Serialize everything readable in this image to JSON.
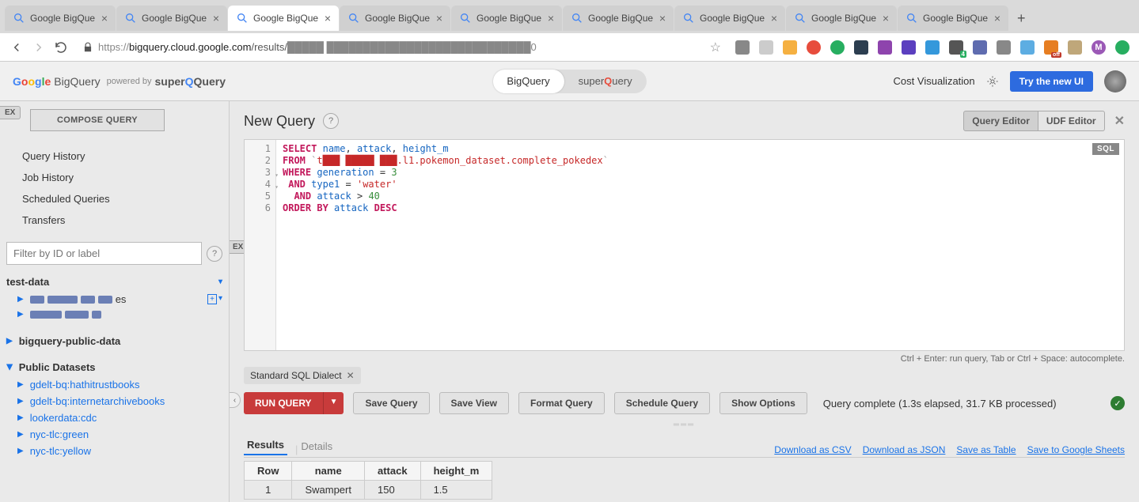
{
  "tabs": {
    "title": "Google BigQue",
    "count": 9,
    "active_index": 2,
    "new_tab_symbol": "+"
  },
  "browser": {
    "url_prefix": "https://",
    "url_host": "bigquery.cloud.google.com",
    "url_path": "/results/",
    "url_obscured": "█████ ████████████████████████████0"
  },
  "app_header": {
    "brand": "BigQuery",
    "powered_by": "powered by",
    "super": "super",
    "query": "Query",
    "toggle_left": "BigQuery",
    "toggle_right": "superQuery",
    "cost_vis": "Cost Visualization",
    "try_btn": "Try the new UI"
  },
  "sidebar": {
    "ex_badge": "EX",
    "compose": "COMPOSE QUERY",
    "links": [
      "Query History",
      "Job History",
      "Scheduled Queries",
      "Transfers"
    ],
    "filter_placeholder": "Filter by ID or label",
    "project1": "test-data",
    "ds1_suffix": "es",
    "project2": "bigquery-public-data",
    "project3": "Public Datasets",
    "public": [
      "gdelt-bq:hathitrustbooks",
      "gdelt-bq:internetarchivebooks",
      "lookerdata:cdc",
      "nyc-tlc:green",
      "nyc-tlc:yellow"
    ]
  },
  "content": {
    "title": "New Query",
    "query_editor": "Query Editor",
    "udf_editor": "UDF Editor",
    "sql_badge": "SQL",
    "hint": "Ctrl + Enter: run query, Tab or Ctrl + Space: autocomplete.",
    "dialect_chip": "Standard SQL Dialect",
    "run": "RUN QUERY",
    "save_query": "Save Query",
    "save_view": "Save View",
    "format_query": "Format Query",
    "schedule_query": "Schedule Query",
    "show_options": "Show Options",
    "status": "Query complete (1.3s elapsed, 31.7 KB processed)",
    "results_tab": "Results",
    "details_tab": "Details",
    "dl_csv": "Download as CSV",
    "dl_json": "Download as JSON",
    "save_table": "Save as Table",
    "save_sheets": "Save to Google Sheets",
    "ex_badge": "EX"
  },
  "sql": {
    "line1": {
      "kw1": "SELECT",
      "a": "name",
      "b": "attack",
      "c": "height_m"
    },
    "line2": {
      "kw": "FROM",
      "bt": "`",
      "proj": "t███ █████ ███.",
      "rest": "l1.pokemon_dataset.complete_pokedex"
    },
    "line3": {
      "kw": "WHERE",
      "col": "generation",
      "op": "=",
      "val": "3"
    },
    "line4": {
      "kw": "AND",
      "col": "type1",
      "op": "=",
      "val": "'water'"
    },
    "line5": {
      "kw": "AND",
      "col": "attack",
      "op": ">",
      "val": "40"
    },
    "line6": {
      "kw1": "ORDER",
      "kw2": "BY",
      "col": "attack",
      "dir": "DESC"
    }
  },
  "results": {
    "headers": [
      "Row",
      "name",
      "attack",
      "height_m"
    ],
    "rows": [
      {
        "row": "1",
        "name": "Swampert",
        "attack": "150",
        "height_m": "1.5"
      }
    ]
  }
}
